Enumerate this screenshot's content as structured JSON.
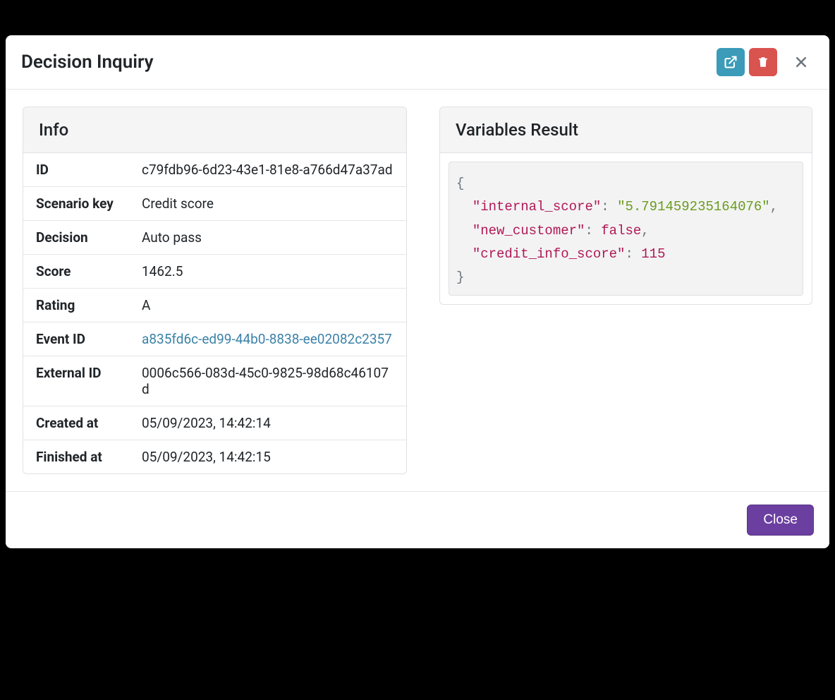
{
  "modal": {
    "title": "Decision Inquiry",
    "close_button_label": "Close"
  },
  "info_panel": {
    "title": "Info",
    "rows": {
      "id_label": "ID",
      "id_value": "c79fdb96-6d23-43e1-81e8-a766d47a37ad",
      "scenario_key_label": "Scenario key",
      "scenario_key_value": "Credit score",
      "decision_label": "Decision",
      "decision_value": "Auto pass",
      "score_label": "Score",
      "score_value": "1462.5",
      "rating_label": "Rating",
      "rating_value": "A",
      "event_id_label": "Event ID",
      "event_id_value": "a835fd6c-ed99-44b0-8838-ee02082c2357",
      "external_id_label": "External ID",
      "external_id_value": "0006c566-083d-45c0-9825-98d68c46107d",
      "created_at_label": "Created at",
      "created_at_value": "05/09/2023, 14:42:14",
      "finished_at_label": "Finished at",
      "finished_at_value": "05/09/2023, 14:42:15"
    }
  },
  "variables_panel": {
    "title": "Variables Result",
    "json": {
      "internal_score_key": "\"internal_score\"",
      "internal_score_value": "\"5.791459235164076\"",
      "new_customer_key": "\"new_customer\"",
      "new_customer_value": "false",
      "credit_info_score_key": "\"credit_info_score\"",
      "credit_info_score_value": "115"
    }
  }
}
